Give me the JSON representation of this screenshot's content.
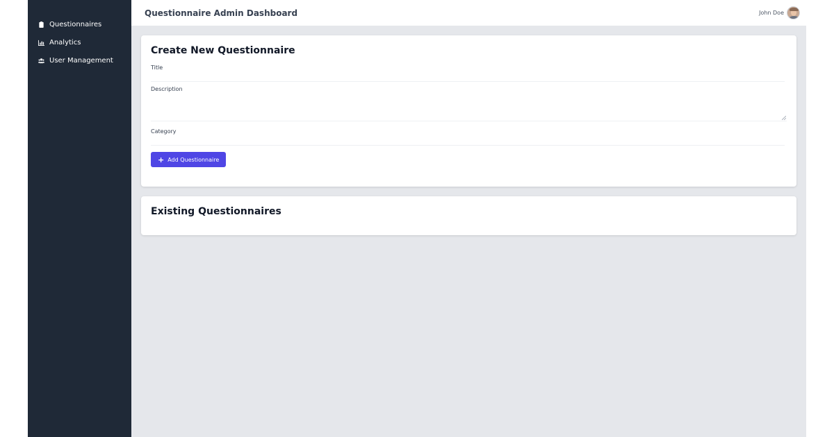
{
  "sidebar": {
    "items": [
      {
        "label": "Questionnaires",
        "icon": "clipboard-icon"
      },
      {
        "label": "Analytics",
        "icon": "bar-chart-icon"
      },
      {
        "label": "User Management",
        "icon": "users-icon"
      }
    ]
  },
  "header": {
    "title": "Questionnaire Admin Dashboard",
    "user_name": "John Doe"
  },
  "create_form": {
    "heading": "Create New Questionnaire",
    "title_label": "Title",
    "title_value": "",
    "description_label": "Description",
    "description_value": "",
    "category_label": "Category",
    "category_value": "",
    "add_button_label": "Add Questionnaire"
  },
  "existing": {
    "heading": "Existing Questionnaires"
  },
  "colors": {
    "sidebar_bg": "#1f2937",
    "main_bg": "#e5e7eb",
    "accent": "#4f46e5"
  }
}
